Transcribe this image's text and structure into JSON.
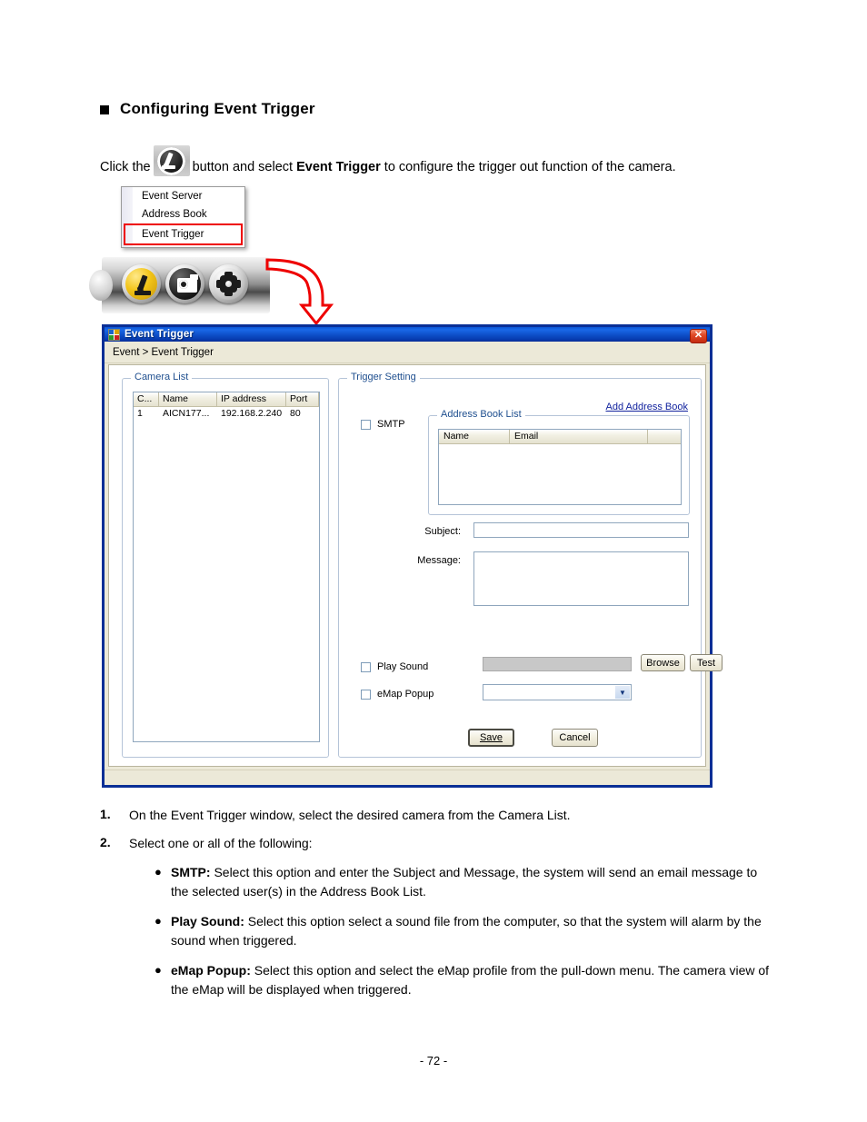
{
  "page": {
    "heading": "Configuring Event Trigger",
    "intro_before": "Click the",
    "intro_middle": "button and select",
    "intro_bold": "Event Trigger",
    "intro_after": "to configure the trigger out function of the camera.",
    "footer": "- 72 -"
  },
  "toolbar_figure": {
    "menu_items": [
      {
        "label": "Event Server",
        "highlighted": false
      },
      {
        "label": "Address Book",
        "highlighted": false
      },
      {
        "label": "Event Trigger",
        "highlighted": true
      }
    ],
    "icons": [
      {
        "name": "pencil-toolbar-icon"
      },
      {
        "name": "camera-toolbar-icon"
      },
      {
        "name": "gear-toolbar-icon"
      }
    ],
    "highlight_color": "#ee0000",
    "arrow_color": "#ee0000"
  },
  "dialog": {
    "title": "Event Trigger",
    "close_label": "✕",
    "breadcrumb": "Event > Event Trigger",
    "camera_list": {
      "group_title": "Camera List",
      "columns": [
        "C...",
        "Name",
        "IP address",
        "Port"
      ],
      "rows": [
        [
          "1",
          "AICN177...",
          "192.168.2.240",
          "80"
        ]
      ]
    },
    "trigger_setting": {
      "group_title": "Trigger Setting",
      "add_address_book_link": "Add Address Book",
      "smtp_label": "SMTP",
      "smtp_checked": false,
      "address_book": {
        "group_title": "Address Book List",
        "columns": [
          "Name",
          "Email",
          ""
        ],
        "rows": []
      },
      "subject_label": "Subject:",
      "subject_value": "",
      "message_label": "Message:",
      "message_value": "",
      "play_sound_label": "Play Sound",
      "play_sound_checked": false,
      "sound_path_value": "",
      "browse_label": "Browse",
      "test_label": "Test",
      "emap_popup_label": "eMap Popup",
      "emap_popup_checked": false,
      "emap_selected": "",
      "emap_options": [],
      "save_label": "Save",
      "cancel_label": "Cancel"
    }
  },
  "steps": [
    {
      "num": "1.",
      "text": "On the Event Trigger window, select the desired camera from the Camera List."
    },
    {
      "num": "2.",
      "text": "Select one or all of the following:"
    }
  ],
  "bullets": [
    {
      "dot": "●",
      "bold": "SMTP:",
      "text": " Select this option and enter the Subject and Message, the system will send an email message to the selected user(s) in the Address Book List."
    },
    {
      "dot": "●",
      "bold": "Play Sound:",
      "text": " Select this option select a sound file from the computer, so that the system will alarm by the sound when triggered."
    },
    {
      "dot": "●",
      "bold": "eMap Popup:",
      "text": " Select this option and select the eMap profile from the pull-down menu. The camera view of the eMap will be displayed when triggered."
    }
  ]
}
